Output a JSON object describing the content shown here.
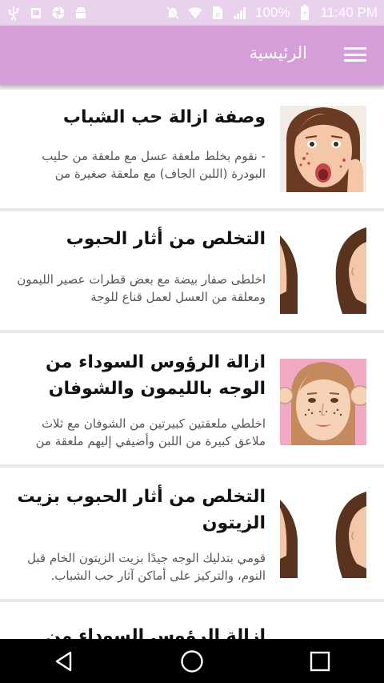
{
  "status_bar": {
    "battery": "100%",
    "time": "11:40 PM",
    "left_icons": [
      "usb-icon",
      "storage-icon",
      "aperture-icon",
      "android-icon"
    ],
    "right_icons": [
      "mute-icon",
      "wifi-icon",
      "no-sim-icon",
      "signal-icon",
      "battery-icon"
    ]
  },
  "app_bar": {
    "title": "الرئيسية",
    "color": "#d59ed9"
  },
  "articles": [
    {
      "title": "وصفة ازالة حب الشباب",
      "body": "- نقوم بخلط ملعقة عسل مع ملعقة من حليب البودرة (اللبن الجاف) مع ملعقة صغيرة من"
    },
    {
      "title": "التخلص من أثار الحبوب",
      "body": "اخلطى صفار بيضة مع بعض قطرات عصير الليمون ومعلقة من العسل لعمل قناع للوجة"
    },
    {
      "title": "ازالة الرؤوس السوداء من الوجه بالليمون والشوفان",
      "body": "اخلطي ملعقتين كبيرتين من الشوفان مع ثلاث ملاعق كبيرة من اللبن وأضيفي إليهم ملعقة من"
    },
    {
      "title": "التخلص من أثار الحبوب بزيت الزيتون",
      "body": "قومي بتدليك الوجه جيدًا بزيت الزيتون الخام قبل النوم، والتركيز على أماكن آثار حب الشباب."
    },
    {
      "title": "ازالة الرؤوس السوداء من الانف",
      "body": ""
    }
  ]
}
